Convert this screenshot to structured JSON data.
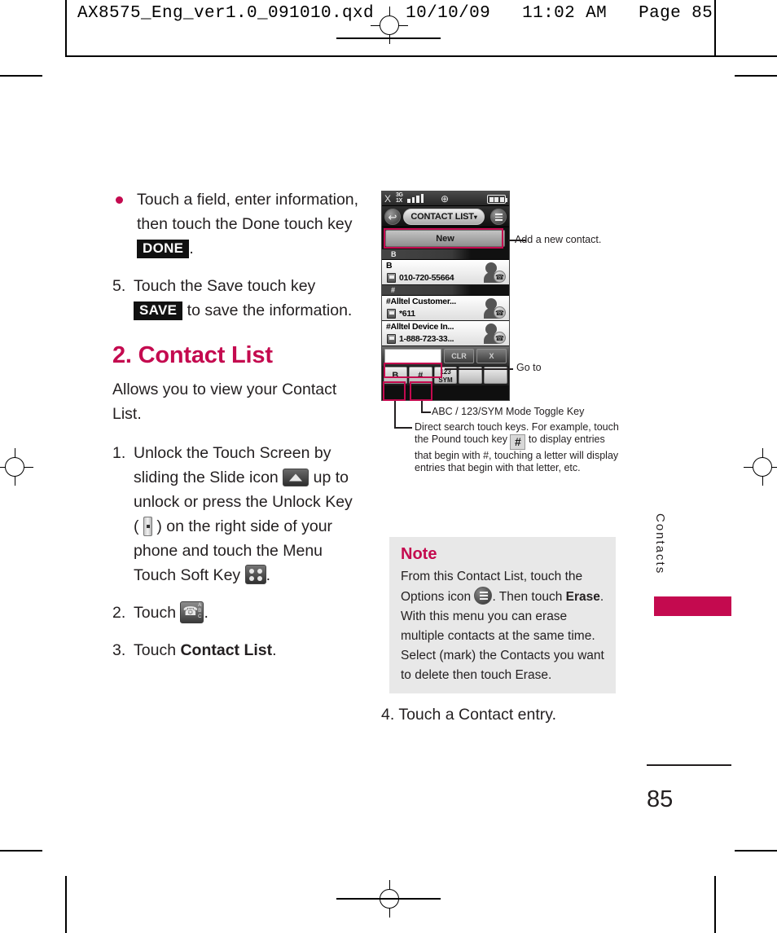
{
  "header": {
    "text": "AX8575_Eng_ver1.0_091010.qxd   10/10/09   11:02 AM   Page 85"
  },
  "left_column": {
    "bullet": {
      "prefix": "Touch a field, enter information, then touch the Done touch key ",
      "keycap": "DONE",
      "suffix": "."
    },
    "step5": {
      "number": "5.",
      "prefix": "Touch the Save touch key ",
      "keycap": "SAVE",
      "suffix": " to save the information."
    },
    "section_title": "2. Contact List",
    "intro": "Allows you to view your Contact List.",
    "step1": {
      "number": "1.",
      "part1": "Unlock the Touch Screen by sliding the Slide icon ",
      "part2": " up to unlock or press the Unlock Key ( ",
      "part3": " ) on the right side of your phone and touch the Menu Touch Soft Key ",
      "part4": "."
    },
    "step2": {
      "number": "2.",
      "part1": "Touch ",
      "part2": "."
    },
    "step3": {
      "number": "3.",
      "part1": "Touch ",
      "bold": "Contact List",
      "part2": "."
    }
  },
  "phone": {
    "status": {
      "antenna_icon": "signal-antenna-icon",
      "network": "3G\n1X",
      "network_line1": "3G",
      "network_line2": "1X",
      "signal_bars": 4,
      "gps_icon": "gps-crosshair-icon",
      "battery_level": 4
    },
    "titlebar": {
      "back_icon": "back-arrow-icon",
      "title": "CONTACT LIST",
      "caret": "▾",
      "options_icon": "options-list-icon"
    },
    "new_button": "New",
    "groups": [
      {
        "label": "B",
        "contacts": [
          {
            "name": "B",
            "number": "010-720-55664",
            "type_icon": "mobile-phone-icon"
          }
        ]
      },
      {
        "label": "#",
        "contacts": [
          {
            "name": "#Alltel Customer...",
            "number": "*611",
            "type_icon": "mobile-phone-icon"
          },
          {
            "name": "#Alltel Device In...",
            "number": "1-888-723-33...",
            "type_icon": "mobile-phone-icon"
          }
        ]
      }
    ],
    "search": {
      "field_value": "",
      "clear_label": "CLR",
      "close_label": "X"
    },
    "keys": [
      {
        "label": "B",
        "sub": ""
      },
      {
        "label": "#",
        "sub": ""
      },
      {
        "label": "123",
        "sub": "SYM"
      },
      {
        "label": "",
        "sub": ""
      },
      {
        "label": "",
        "sub": ""
      }
    ]
  },
  "callouts": {
    "new": "Add a new contact.",
    "goto": "Go to",
    "toggle": "ABC / 123/SYM Mode Toggle Key",
    "direct_search_part1": "Direct search touch keys. For example, touch the Pound touch key ",
    "direct_search_key": "#",
    "direct_search_part2": " to display entries that begin with #, touching a letter will display entries that begin with that letter, etc."
  },
  "note": {
    "title": "Note",
    "part1": "From this Contact List, touch the Options icon ",
    "part2": ". Then touch ",
    "bold": "Erase",
    "part3": ". With this menu you can erase multiple contacts at the same time. Select (mark) the Contacts you want to delete then touch Erase."
  },
  "step4": "4. Touch a Contact entry.",
  "sidebar": {
    "tab_label": "Contacts"
  },
  "page_number": "85",
  "colors": {
    "accent": "#c40a4f",
    "text": "#231f20",
    "note_bg": "#e8e8e8"
  }
}
